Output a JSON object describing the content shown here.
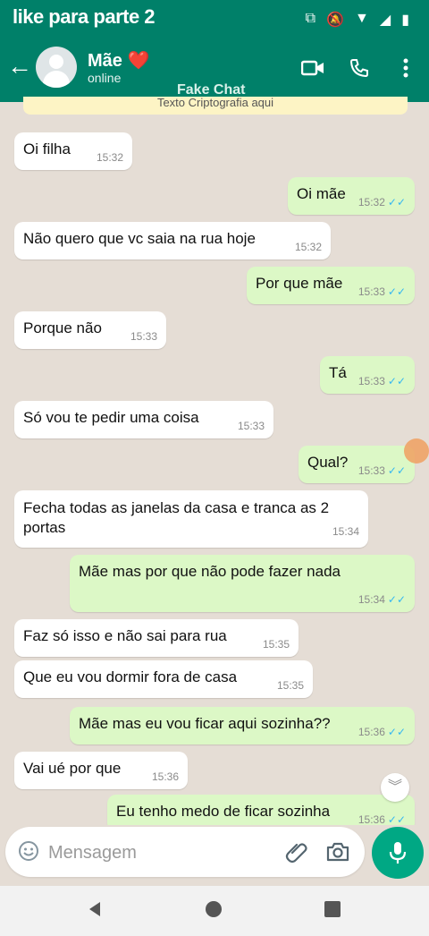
{
  "overlay": {
    "title": "like para parte 2",
    "watermark": "Fake Chat"
  },
  "header": {
    "back_icon": "arrow-left-icon",
    "contact_name": "Mãe ❤️",
    "contact_status": "online",
    "actions": [
      "video-call-icon",
      "phone-icon",
      "more-vertical-icon"
    ]
  },
  "banner": {
    "text": "Texto Criptografia aqui"
  },
  "messages": [
    {
      "dir": "in",
      "text": "Oi filha",
      "time": "15:32"
    },
    {
      "dir": "out",
      "text": "Oi mãe",
      "time": "15:32",
      "read": true
    },
    {
      "dir": "in",
      "text": "Não quero que vc saia na rua hoje",
      "time": "15:32"
    },
    {
      "dir": "out",
      "text": "Por que mãe",
      "time": "15:33",
      "read": true
    },
    {
      "dir": "in",
      "text": "Porque não",
      "time": "15:33"
    },
    {
      "dir": "out",
      "text": "Tá",
      "time": "15:33",
      "read": true
    },
    {
      "dir": "in",
      "text": "Só vou te pedir uma coisa",
      "time": "15:33"
    },
    {
      "dir": "out",
      "text": "Qual?",
      "time": "15:33",
      "read": true
    },
    {
      "dir": "in",
      "text": "Fecha todas as janelas da casa e tranca as 2 portas",
      "time": "15:34"
    },
    {
      "dir": "out",
      "text": "Mãe mas por que não pode fazer nada",
      "time": "15:34",
      "read": true
    },
    {
      "dir": "in",
      "text": "Faz só isso e não sai para rua",
      "time": "15:35"
    },
    {
      "dir": "in",
      "text": "Que eu vou dormir fora de casa",
      "time": "15:35"
    },
    {
      "dir": "out",
      "text": "Mãe mas eu vou ficar aqui sozinha??",
      "time": "15:36",
      "read": true
    },
    {
      "dir": "in",
      "text": "Vai ué por que",
      "time": "15:36"
    },
    {
      "dir": "out",
      "text": "Eu tenho medo de ficar sozinha",
      "time": "15:36",
      "read": true
    }
  ],
  "composer": {
    "placeholder": "Mensagem"
  },
  "colors": {
    "header": "#008069",
    "outgoing": "#dcf8c6",
    "incoming": "#ffffff",
    "accent": "#00a884",
    "tick": "#34b7f1"
  }
}
